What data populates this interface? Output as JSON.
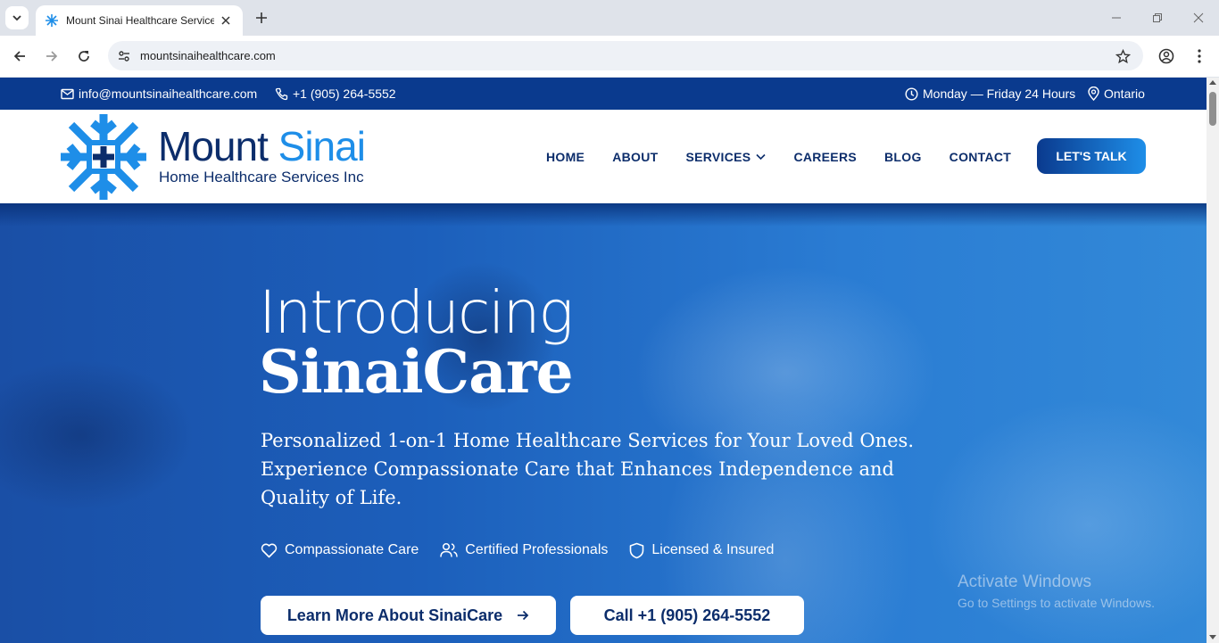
{
  "browser": {
    "tab_title": "Mount Sinai Healthcare Services",
    "url": "mountsinaihealthcare.com"
  },
  "topbar": {
    "email": "info@mountsinaihealthcare.com",
    "phone": "+1 (905) 264-5552",
    "hours": "Monday — Friday 24 Hours",
    "location": "Ontario"
  },
  "header": {
    "logo_word1": "Mount",
    "logo_word2": "Sinai",
    "logo_subtitle": "Home Healthcare Services Inc",
    "menu": [
      "HOME",
      "ABOUT",
      "SERVICES",
      "CAREERS",
      "BLOG",
      "CONTACT"
    ],
    "cta": "LET'S TALK"
  },
  "hero": {
    "title_line1": "Introducing",
    "title_line2": "SinaiCare",
    "description": "Personalized 1-on-1 Home Healthcare Services for Your Loved Ones. Experience Compassionate Care that Enhances Independence and Quality of Life.",
    "features": [
      "Compassionate Care",
      "Certified Professionals",
      "Licensed & Insured"
    ],
    "primary_button": "Learn More About SinaiCare",
    "secondary_button": "Call +1 (905) 264-5552"
  },
  "watermark": {
    "line1": "Activate Windows",
    "line2": "Go to Settings to activate Windows."
  },
  "colors": {
    "brand_navy": "#0a3a8e",
    "brand_blue": "#1e8ee8",
    "text_navy": "#0c2d6b"
  }
}
